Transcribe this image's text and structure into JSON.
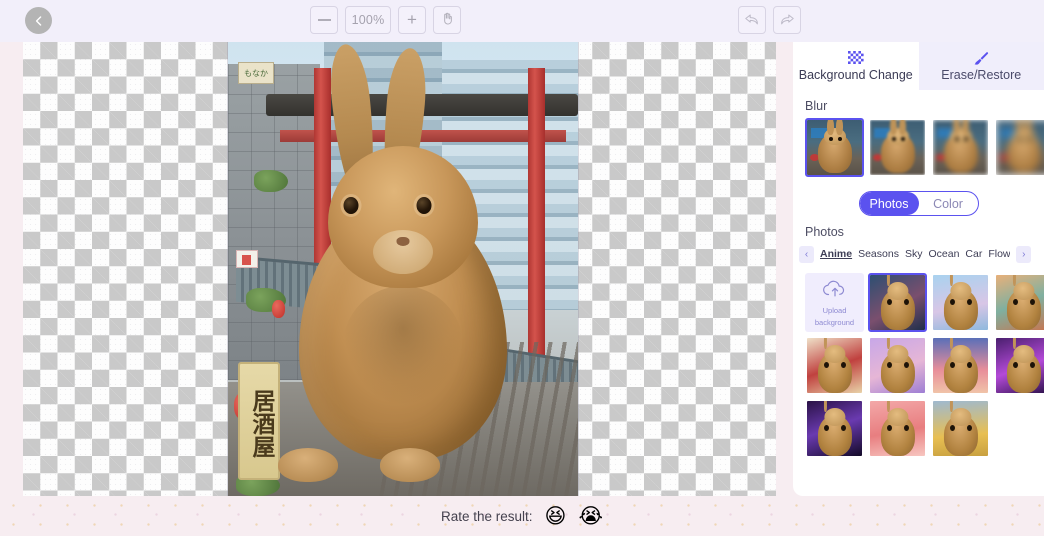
{
  "toolbar": {
    "back_icon": "chevron-left-icon",
    "zoom_out_label": "—",
    "zoom_level": "100%",
    "zoom_in_label": "+",
    "pan_icon": "hand-icon",
    "undo_icon": "undo-arrow-icon",
    "redo_icon": "redo-arrow-icon"
  },
  "panel": {
    "tabs": [
      {
        "label": "Background Change",
        "icon": "checkerboard-icon",
        "active": true
      },
      {
        "label": "Erase/Restore",
        "icon": "brush-icon",
        "active": false
      }
    ],
    "blur": {
      "label": "Blur",
      "options": [
        {
          "name": "blur-none",
          "selected": true
        },
        {
          "name": "blur-light",
          "selected": false
        },
        {
          "name": "blur-medium",
          "selected": false
        },
        {
          "name": "blur-strong",
          "selected": false
        }
      ]
    },
    "mode_toggle": {
      "photos_label": "Photos",
      "color_label": "Color",
      "selected": "Photos"
    },
    "photos": {
      "label": "Photos",
      "prev_arrow": "‹",
      "next_arrow": "›",
      "categories": [
        {
          "label": "Anime",
          "active": true
        },
        {
          "label": "Seasons",
          "active": false
        },
        {
          "label": "Sky",
          "active": false
        },
        {
          "label": "Ocean",
          "active": false
        },
        {
          "label": "Car",
          "active": false
        },
        {
          "label": "Flow",
          "active": false
        }
      ],
      "upload": {
        "icon": "cloud-upload-icon",
        "line1": "Upload",
        "line2": "background"
      },
      "thumbnails": [
        {
          "name": "bg-anime-street-night",
          "selected": true,
          "c1": "#2d4f72",
          "c2": "#7a4f6e",
          "c3": "#1f2f4a"
        },
        {
          "name": "bg-anime-sky-clouds",
          "selected": false,
          "c1": "#a9d2ef",
          "c2": "#d8c6e6",
          "c3": "#8fb9dd"
        },
        {
          "name": "bg-anime-temple-sunset",
          "selected": false,
          "c1": "#e8b07a",
          "c2": "#7fb0a0",
          "c3": "#c8744f"
        },
        {
          "name": "bg-anime-red-room",
          "selected": false,
          "c1": "#efe0c8",
          "c2": "#c0413f",
          "c3": "#e8d2a8"
        },
        {
          "name": "bg-anime-pink-city",
          "selected": false,
          "c1": "#c7a7e8",
          "c2": "#e6b6d6",
          "c3": "#9e7ed4"
        },
        {
          "name": "bg-anime-dusk-field",
          "selected": false,
          "c1": "#5a6fb8",
          "c2": "#e88e9a",
          "c3": "#f0c3a8"
        },
        {
          "name": "bg-anime-neon-alley",
          "selected": false,
          "c1": "#4a1f6e",
          "c2": "#b44ad8",
          "c3": "#2a1048"
        },
        {
          "name": "bg-anime-cyber-night",
          "selected": false,
          "c1": "#2a1246",
          "c2": "#6a3ab0",
          "c3": "#130a28"
        },
        {
          "name": "bg-anime-pink-mountain",
          "selected": false,
          "c1": "#f3a8a8",
          "c2": "#e87e80",
          "c3": "#f7c6c0"
        },
        {
          "name": "bg-anime-golden-field",
          "selected": false,
          "c1": "#9fb9cf",
          "c2": "#e8bf52",
          "c3": "#c8a040"
        }
      ]
    }
  },
  "canvas": {
    "subject": "rabbit-cutout",
    "background_scene": "anime-japanese-street",
    "sign_text": "居酒屋",
    "small_sign_text": "もなか"
  },
  "footer": {
    "rate_label": "Rate the result:",
    "happy_emoji": "😆",
    "sad_emoji": "😭"
  },
  "colors": {
    "accent": "#5b52ef",
    "toolbar_bg": "#f2effa",
    "page_bg": "#f7edf1",
    "panel_bg": "#ffffff"
  }
}
